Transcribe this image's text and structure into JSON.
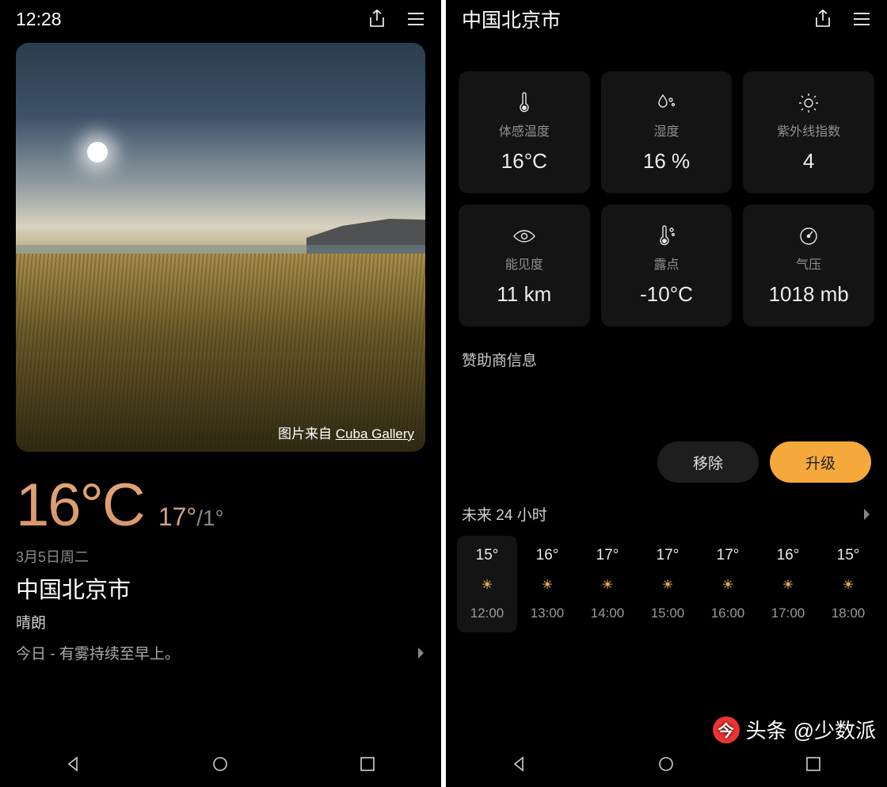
{
  "left": {
    "status_time": "12:28",
    "image_credit_prefix": "图片来自 ",
    "image_credit_source": "Cuba Gallery",
    "temp_main": "16°C",
    "temp_high": "17°",
    "temp_sep": "/",
    "temp_low": "1°",
    "date": "3月5日周二",
    "location": "中国北京市",
    "condition": "晴朗",
    "summary": "今日 - 有雾持续至早上。"
  },
  "right": {
    "title": "中国北京市",
    "cards": [
      {
        "icon": "thermometer-icon",
        "label": "体感温度",
        "value": "16°C"
      },
      {
        "icon": "humidity-icon",
        "label": "湿度",
        "value": "16 %"
      },
      {
        "icon": "uv-icon",
        "label": "紫外线指数",
        "value": "4"
      },
      {
        "icon": "eye-icon",
        "label": "能见度",
        "value": "11 km"
      },
      {
        "icon": "dewpoint-icon",
        "label": "露点",
        "value": "-10°C"
      },
      {
        "icon": "gauge-icon",
        "label": "气压",
        "value": "1018 mb"
      }
    ],
    "sponsor_label": "赞助商信息",
    "remove_label": "移除",
    "upgrade_label": "升级",
    "hours_title": "未来 24 小时",
    "hours": [
      {
        "temp": "15°",
        "time": "12:00",
        "selected": true
      },
      {
        "temp": "16°",
        "time": "13:00",
        "selected": false
      },
      {
        "temp": "17°",
        "time": "14:00",
        "selected": false
      },
      {
        "temp": "17°",
        "time": "15:00",
        "selected": false
      },
      {
        "temp": "17°",
        "time": "16:00",
        "selected": false
      },
      {
        "temp": "16°",
        "time": "17:00",
        "selected": false
      },
      {
        "temp": "15°",
        "time": "18:00",
        "selected": false
      }
    ]
  },
  "watermark": {
    "prefix": "头条",
    "handle": "@少数派"
  }
}
